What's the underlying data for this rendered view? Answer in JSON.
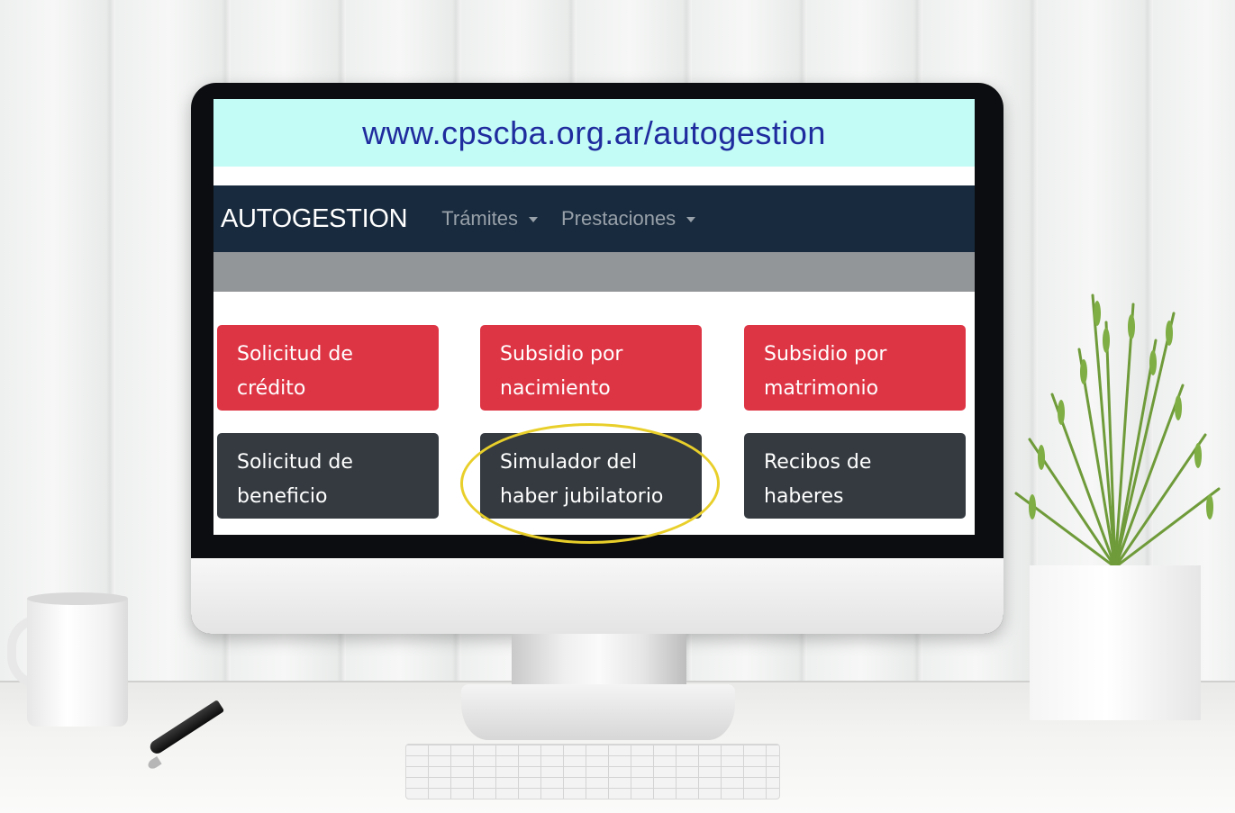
{
  "url_bar": {
    "text": "www.cpscba.org.ar/autogestion"
  },
  "navbar": {
    "brand": "AUTOGESTION",
    "items": [
      {
        "label": "Trámites"
      },
      {
        "label": "Prestaciones"
      }
    ]
  },
  "tiles": [
    {
      "label": "Solicitud de\ncrédito",
      "color": "#de3545"
    },
    {
      "label": "Subsidio por\nnacimiento",
      "color": "#de3545"
    },
    {
      "label": "Subsidio por\nmatrimonio",
      "color": "#de3545"
    },
    {
      "label": "Solicitud de\nbeneficio",
      "color": "#343a40"
    },
    {
      "label": "Simulador del\nhaber jubilatorio",
      "color": "#343a40"
    },
    {
      "label": "Recibos de\nhaberes",
      "color": "#343a40"
    }
  ],
  "highlight": {
    "target": "Simulador del haber jubilatorio",
    "color": "#e9cf2a"
  },
  "colors": {
    "url_bar_bg": "#c3fbf6",
    "url_text": "#1f2c9e",
    "navbar_bg": "#182a3d",
    "gray_band": "#939699"
  },
  "icons": [
    "caret-down-icon"
  ]
}
